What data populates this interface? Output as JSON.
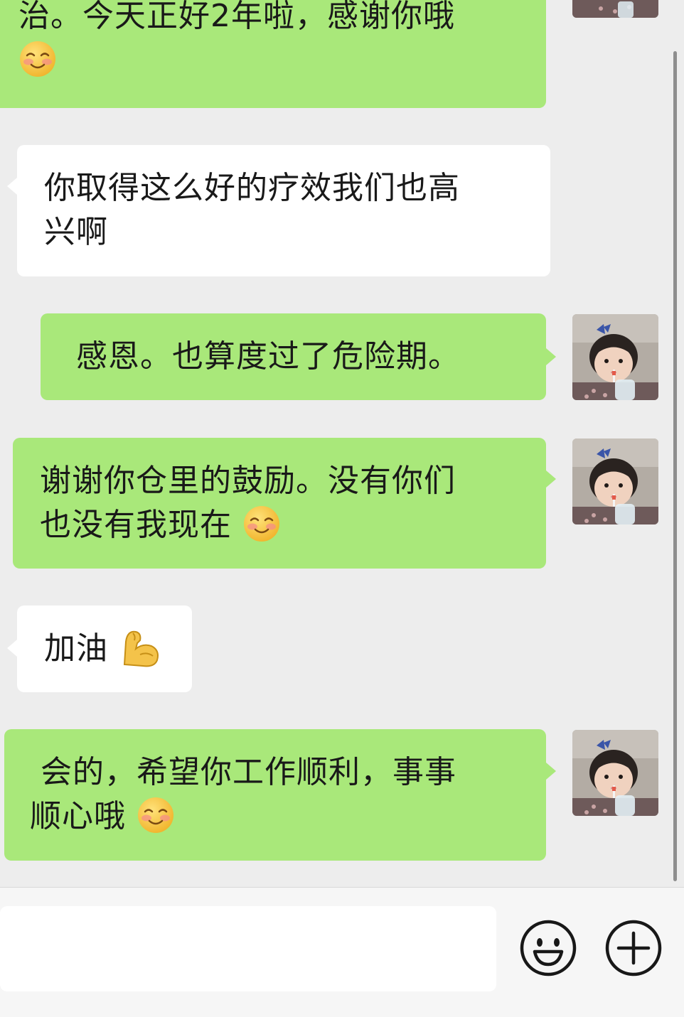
{
  "messages": [
    {
      "side": "sent",
      "lines": [
        "治。今天正好2年啦，感谢你哦"
      ],
      "trailing_emoji": "blush-emoji"
    },
    {
      "side": "received",
      "lines": [
        "你取得这么好的疗效我们也高",
        "兴啊"
      ]
    },
    {
      "side": "sent",
      "lines": [
        "感恩。也算度过了危险期。"
      ]
    },
    {
      "side": "sent",
      "lines": [
        "谢谢你仓里的鼓励。没有你们",
        "也没有我现在"
      ],
      "trailing_emoji": "blush-emoji"
    },
    {
      "side": "received",
      "lines": [
        "加油"
      ],
      "trailing_emoji": "flexed-biceps-emoji"
    },
    {
      "side": "sent",
      "lines": [
        " 会的，希望你工作顺利，事事",
        "顺心哦"
      ],
      "trailing_emoji": "blush-emoji"
    }
  ],
  "input": {
    "emoji_button_icon": "smiley-face-icon",
    "more_button_icon": "plus-circle-icon"
  },
  "colors": {
    "sent_bubble": "#a9e87a",
    "received_bubble": "#ffffff",
    "chat_background": "#ededed"
  }
}
